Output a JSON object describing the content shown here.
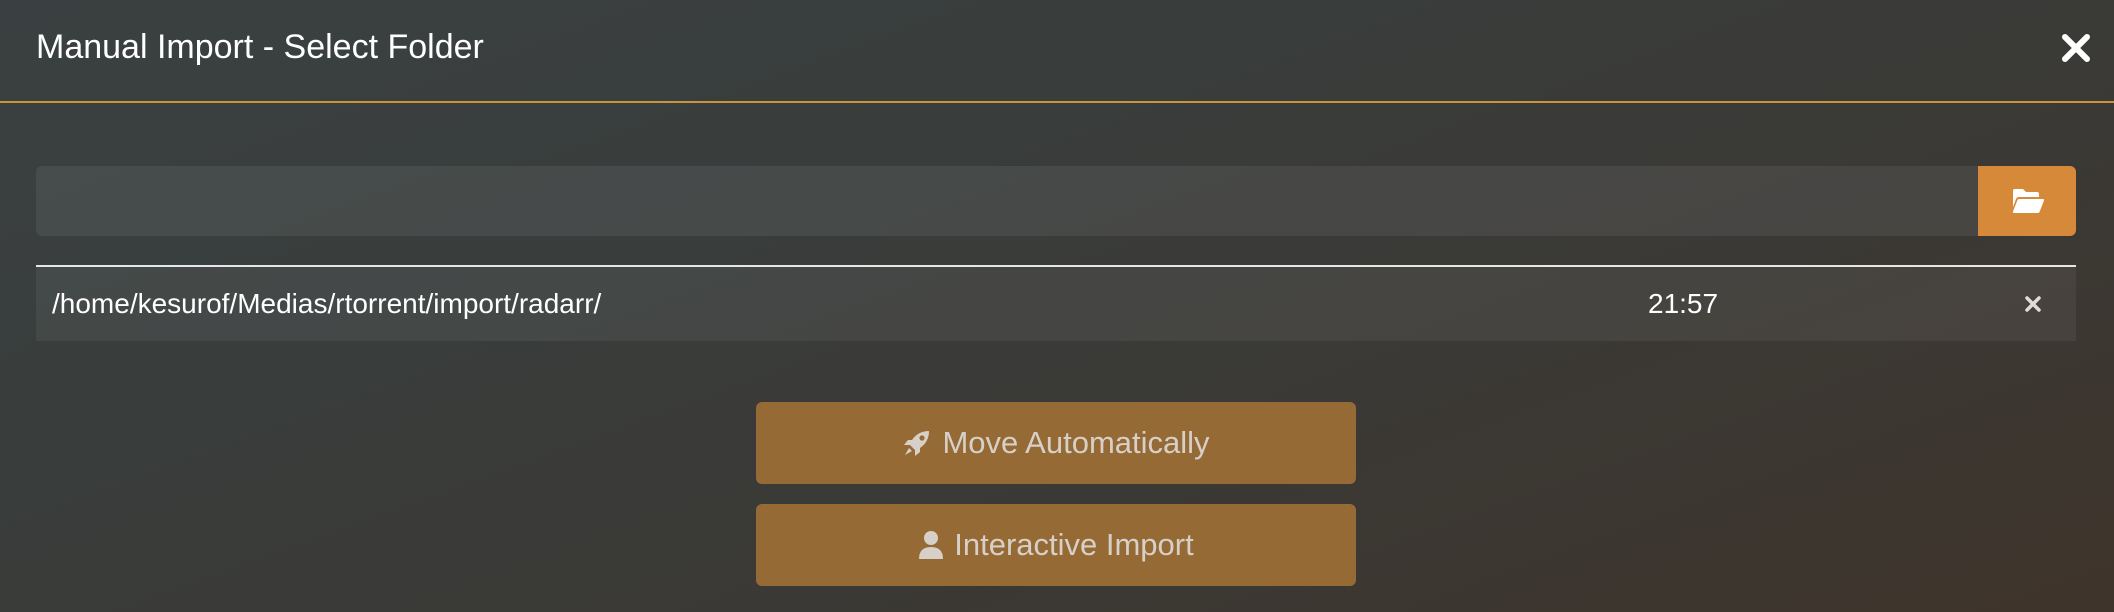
{
  "modal": {
    "title": "Manual Import - Select Folder",
    "close_icon": "close-icon"
  },
  "path_input": {
    "value": "",
    "placeholder": "",
    "browse_icon": "folder-open-icon"
  },
  "recent_folders": [
    {
      "path": "/home/kesurof/Medias/rtorrent/import/radarr/",
      "time": "21:57",
      "remove_icon": "remove-icon"
    }
  ],
  "buttons": {
    "move_automatically": {
      "label": "Move Automatically",
      "icon": "rocket-icon"
    },
    "interactive_import": {
      "label": "Interactive Import",
      "icon": "user-icon"
    }
  },
  "colors": {
    "accent": "#d7893a",
    "button_bg": "#966a35",
    "header_border": "#c7953c"
  }
}
